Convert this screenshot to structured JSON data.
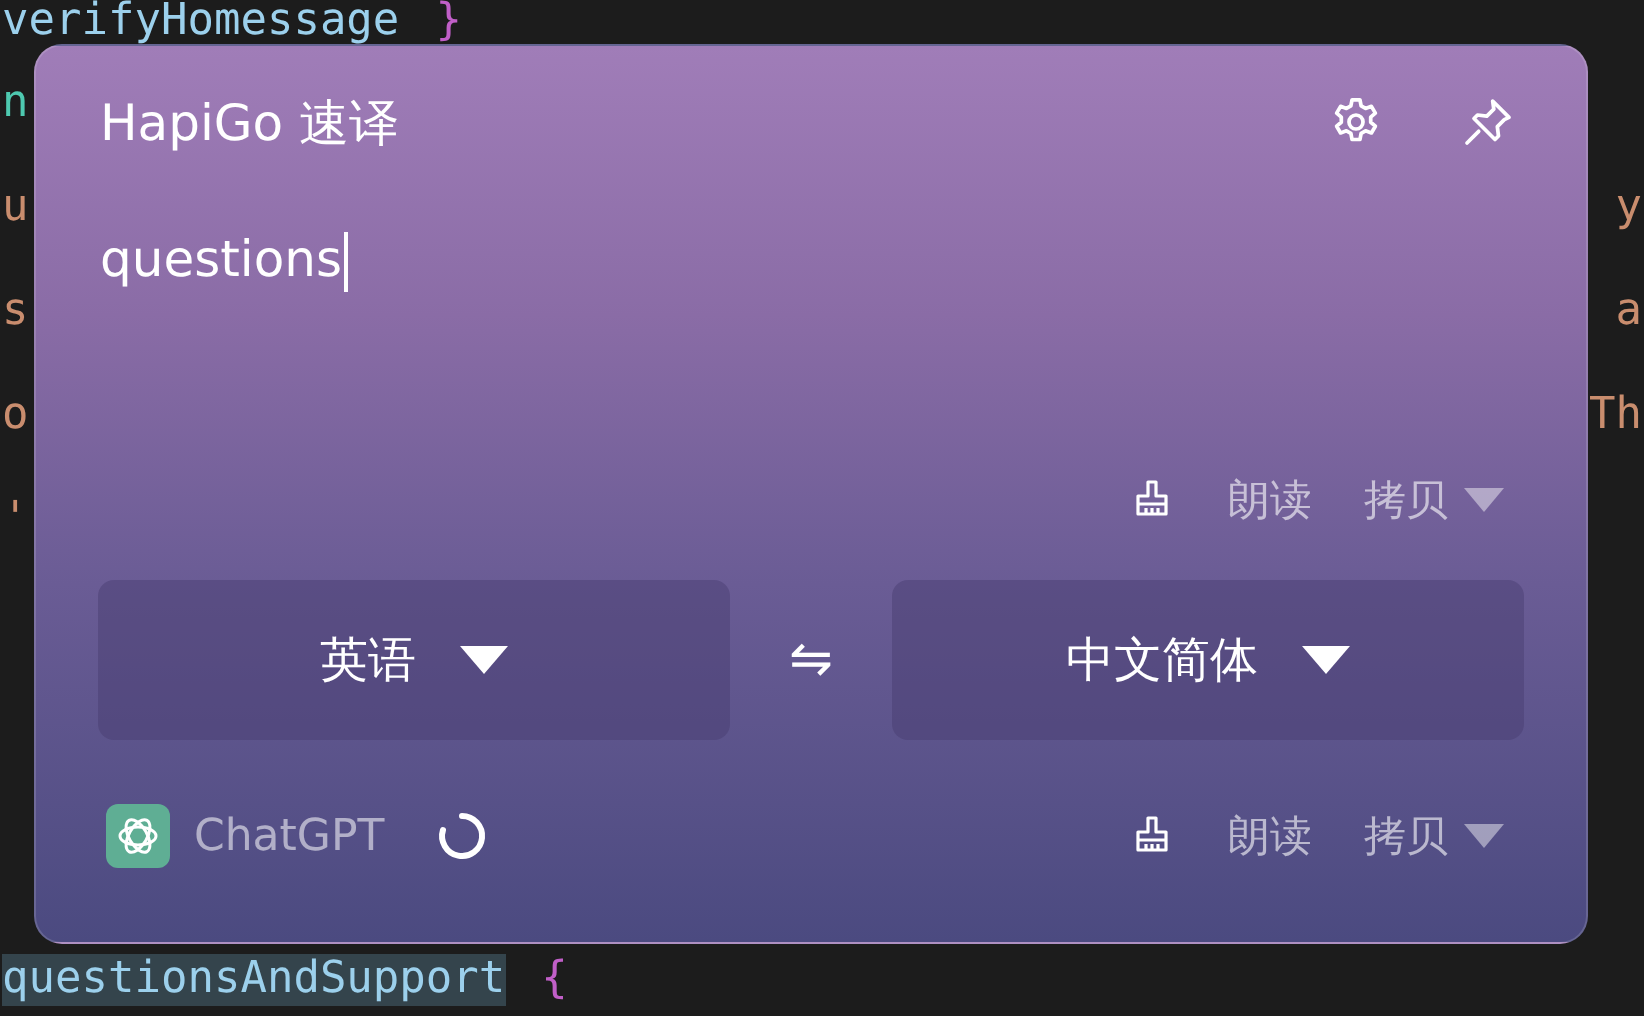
{
  "editor": {
    "lines": [
      {
        "left": [
          {
            "text": "verifyHomessage",
            "kind": "identifier",
            "selected": false
          },
          {
            "text": "}",
            "kind": "brace",
            "selected": false
          }
        ]
      },
      {
        "left": [
          {
            "text": "n",
            "kind": "keyword",
            "selected": false
          }
        ]
      },
      {
        "left": [
          {
            "text": "u",
            "kind": "string",
            "selected": false
          }
        ],
        "right": [
          {
            "text": "y",
            "kind": "string",
            "selected": false
          }
        ]
      },
      {
        "left": [
          {
            "text": "s",
            "kind": "string",
            "selected": false
          }
        ],
        "right": [
          {
            "text": "a",
            "kind": "string",
            "selected": false
          }
        ]
      },
      {
        "left": [
          {
            "text": "o",
            "kind": "string",
            "selected": false
          }
        ],
        "right": [
          {
            "text": "Th",
            "kind": "string",
            "selected": false
          }
        ]
      },
      {
        "left": [
          {
            "text": "'",
            "kind": "string",
            "selected": false
          }
        ]
      },
      {
        "left": [
          {
            "text": "questionsAndSupport",
            "kind": "identifier",
            "selected": true
          },
          {
            "text": "{",
            "kind": "brace",
            "selected": false
          }
        ]
      }
    ]
  },
  "window": {
    "title": "HapiGo 速译",
    "input": {
      "value": "questions",
      "focused": true
    },
    "source_actions": [
      {
        "kind": "clear"
      },
      {
        "kind": "text",
        "label": "朗读"
      },
      {
        "kind": "dropdown",
        "label": "拷贝"
      }
    ],
    "languages": {
      "source": "英语",
      "swap": "⇋",
      "target": "中文简体"
    },
    "result": {
      "engine": "ChatGPT",
      "loading": true,
      "actions": [
        {
          "kind": "clear"
        },
        {
          "kind": "text",
          "label": "朗读"
        },
        {
          "kind": "dropdown",
          "label": "拷贝"
        }
      ]
    }
  }
}
